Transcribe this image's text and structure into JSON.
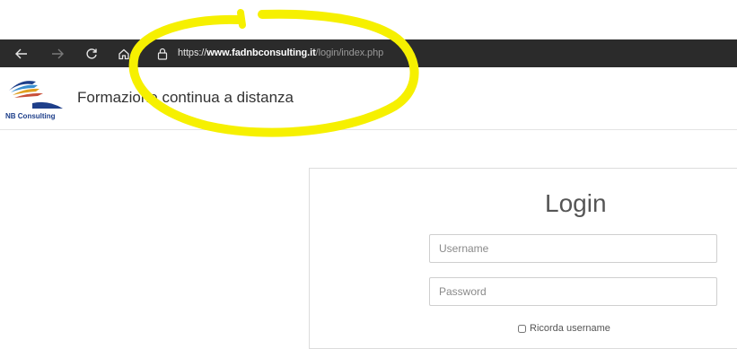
{
  "browser": {
    "url_prefix": "https://",
    "url_host": "www.fadnbconsulting.it",
    "url_path": "/login/index.php",
    "icons": [
      "back-arrow-icon",
      "forward-arrow-icon",
      "refresh-icon",
      "home-icon",
      "lock-icon"
    ]
  },
  "site": {
    "logo_text": "NB Consulting",
    "title": "Formazione continua a distanza"
  },
  "login": {
    "title": "Login",
    "username_placeholder": "Username",
    "password_placeholder": "Password",
    "remember_label": "Ricorda username"
  },
  "colors": {
    "toolbar_bg": "#2b2b2b",
    "highlight": "#f6f000"
  }
}
